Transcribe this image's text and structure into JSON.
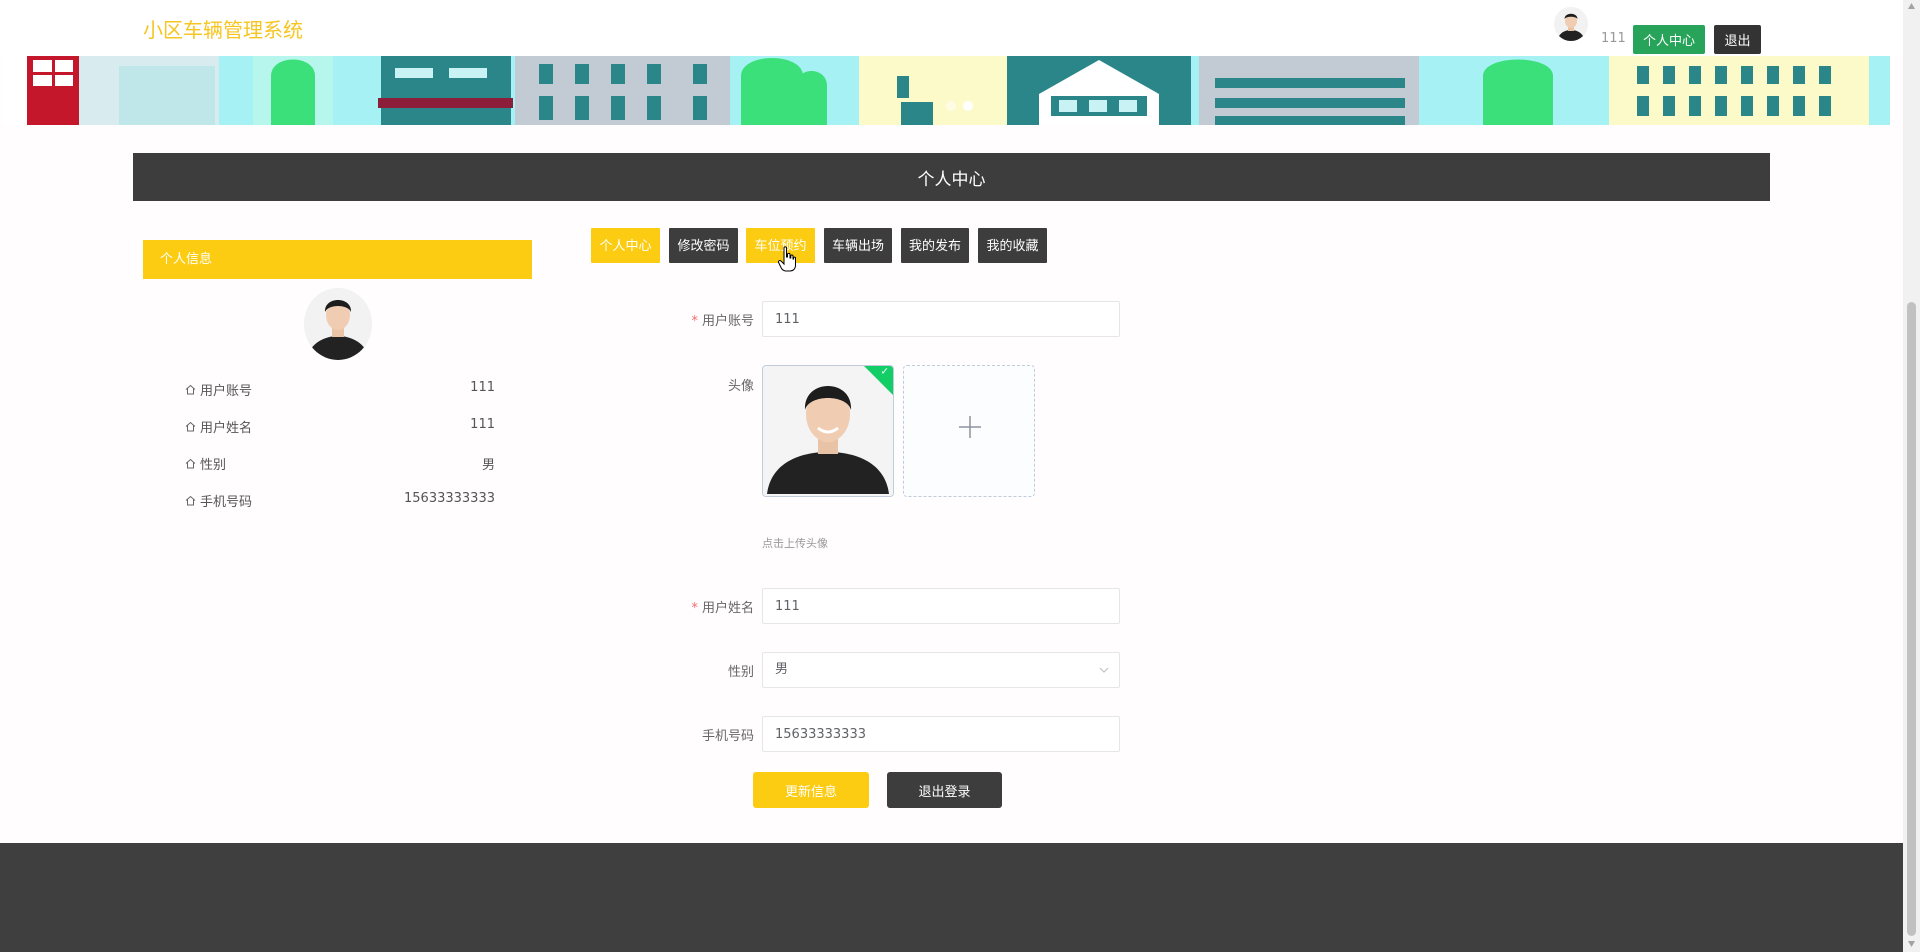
{
  "header": {
    "app_title": "小区车辆管理系统",
    "username": "111",
    "center_button": "个人中心",
    "logout_button": "退出"
  },
  "section_title": "个人中心",
  "sidebar": {
    "title": "个人信息",
    "rows": [
      {
        "label": "用户账号",
        "value": "111"
      },
      {
        "label": "用户姓名",
        "value": "111"
      },
      {
        "label": "性别",
        "value": "男"
      },
      {
        "label": "手机号码",
        "value": "15633333333"
      }
    ]
  },
  "tabs": [
    {
      "label": "个人中心",
      "active": true
    },
    {
      "label": "修改密码",
      "active": false
    },
    {
      "label": "车位预约",
      "active": true
    },
    {
      "label": "车辆出场",
      "active": false
    },
    {
      "label": "我的发布",
      "active": false
    },
    {
      "label": "我的收藏",
      "active": false
    }
  ],
  "form": {
    "account_label": "用户账号",
    "account_value": "111",
    "avatar_label": "头像",
    "upload_tip": "点击上传头像",
    "name_label": "用户姓名",
    "name_value": "111",
    "gender_label": "性别",
    "gender_value": "男",
    "phone_label": "手机号码",
    "phone_value": "15633333333",
    "update_button": "更新信息",
    "logout_button": "退出登录"
  },
  "colors": {
    "accent_yellow": "#fccc13",
    "dark": "#3d3d3d",
    "green": "#27a35a"
  }
}
